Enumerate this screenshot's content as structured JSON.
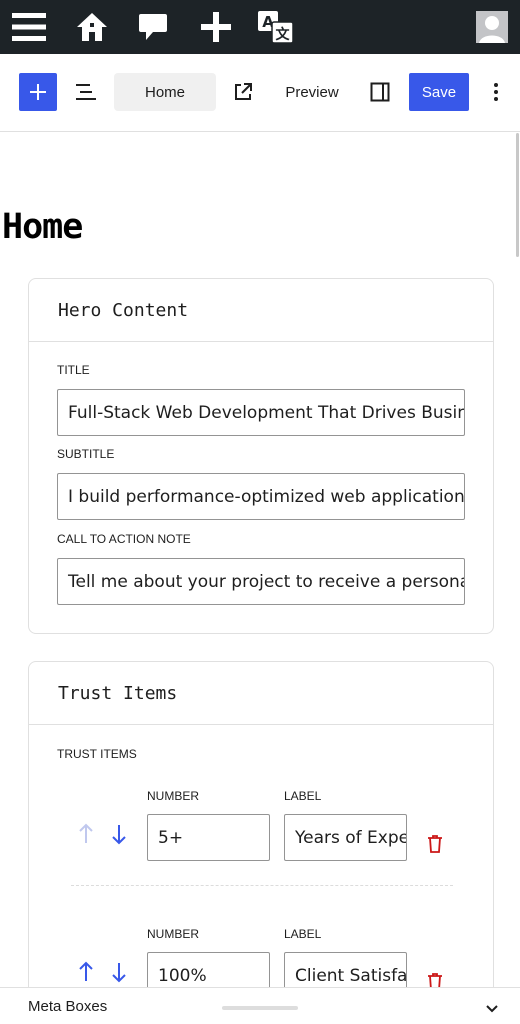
{
  "admin_bar": {
    "icons": [
      "menu-icon",
      "home-icon",
      "comment-icon",
      "plus-icon",
      "translate-icon"
    ],
    "avatar": "avatar"
  },
  "toolbar": {
    "document_title": "Home",
    "preview_label": "Preview",
    "save_label": "Save"
  },
  "page": {
    "title": "Home"
  },
  "hero_panel": {
    "heading": "Hero Content",
    "fields": [
      {
        "label": "TITLE",
        "value": "Full-Stack Web Development That Drives Business Growth"
      },
      {
        "label": "SUBTITLE",
        "value": "I build performance-optimized web applications"
      },
      {
        "label": "CALL TO ACTION NOTE",
        "value": "Tell me about your project to receive a personalized"
      }
    ]
  },
  "trust_panel": {
    "heading": "Trust Items",
    "list_label": "TRUST ITEMS",
    "number_label": "NUMBER",
    "label_label": "LABEL",
    "items": [
      {
        "number": "5+",
        "label": "Years of Experience"
      },
      {
        "number": "100%",
        "label": "Client Satisfaction"
      }
    ]
  },
  "meta_boxes": {
    "label": "Meta Boxes"
  },
  "colors": {
    "accent": "#3858e9",
    "admin_bar": "#1d2327",
    "danger": "#cc1818",
    "disabled": "#c0c8ee"
  }
}
